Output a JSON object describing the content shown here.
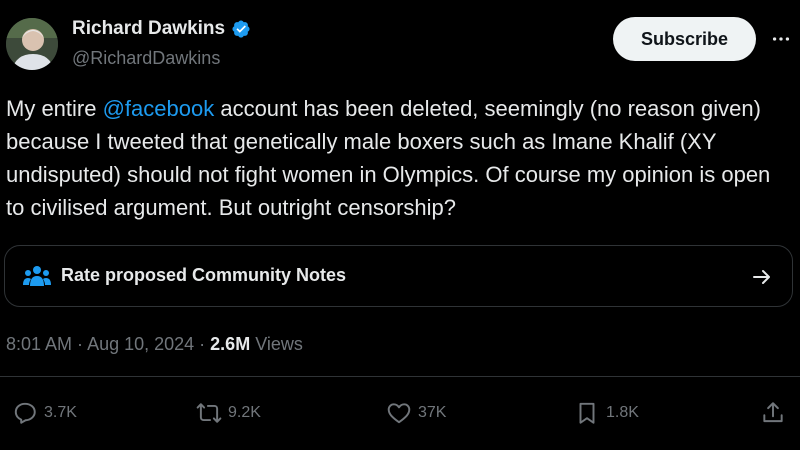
{
  "author": {
    "name": "Richard Dawkins",
    "handle": "@RichardDawkins",
    "avatar_icon": "profile-photo",
    "verified_icon": "verified-badge-icon",
    "verified_color": "#1d9bf0"
  },
  "header": {
    "subscribe_label": "Subscribe",
    "more_icon": "more-icon"
  },
  "tweet": {
    "text_before": "My entire ",
    "mention": "@facebook",
    "text_after": " account has been deleted, seemingly (no reason given) because I tweeted that genetically male boxers such as Imane Khalif (XY undisputed) should not fight women in Olympics. Of course my opinion is open to civilised argument. But outright censorship?",
    "mention_color": "#1d9bf0"
  },
  "community_notes": {
    "label": "Rate proposed Community Notes",
    "icon": "community-notes-icon",
    "icon_color": "#1d9bf0",
    "arrow_icon": "arrow-right-icon"
  },
  "meta": {
    "time": "8:01 AM",
    "separator": " · ",
    "date": "Aug 10, 2024",
    "views_count": "2.6M",
    "views_label": " Views"
  },
  "actions": {
    "replies": "3.7K",
    "reposts": "9.2K",
    "likes": "37K",
    "bookmarks": "1.8K"
  },
  "colors": {
    "background": "#000000",
    "text": "#e7e9ea",
    "muted": "#71767b",
    "border": "#2f3336"
  }
}
